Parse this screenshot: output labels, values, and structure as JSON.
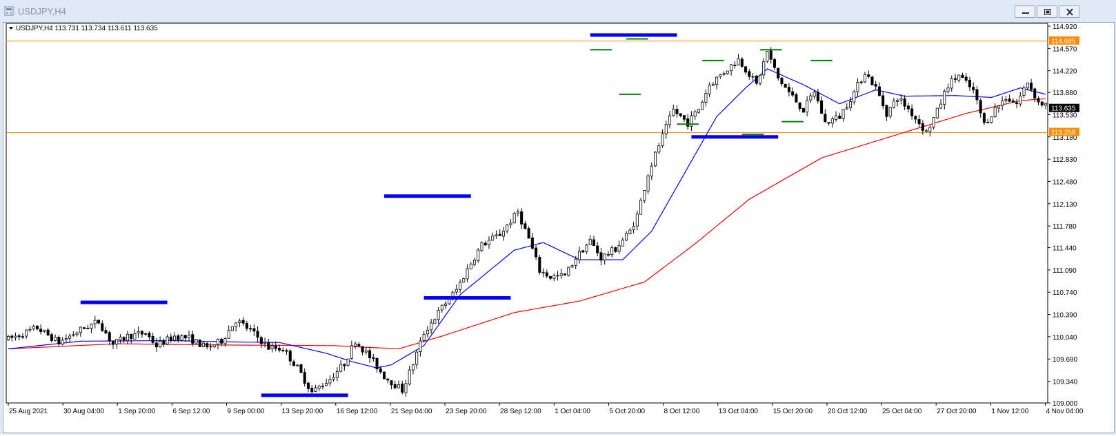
{
  "window": {
    "title": "USDJPY,H4",
    "buttons": [
      "minimize",
      "restore",
      "close"
    ]
  },
  "info": {
    "symbol": "USDJPY,H4",
    "ohlc": "113.731 113.734 113.611 113.635"
  },
  "colors": {
    "bull": "#ffffff",
    "bear": "#000000",
    "ma_fast": "#0000ff",
    "ma_slow": "#ff0000",
    "level": "#ff8c00",
    "zone": "#0000ff",
    "pivot": "#008000",
    "current_price_bg": "#000000"
  },
  "chart_data": {
    "type": "candlestick",
    "title": "USDJPY,H4",
    "ylim": [
      109.0,
      114.92
    ],
    "y_ticks": [
      "114.920",
      "114.570",
      "114.220",
      "113.880",
      "113.530",
      "113.180",
      "112.830",
      "112.480",
      "112.130",
      "111.780",
      "111.440",
      "111.090",
      "110.740",
      "110.390",
      "110.040",
      "109.690",
      "109.340",
      "109.000"
    ],
    "x_ticks": [
      "25 Aug 2021",
      "30 Aug 04:00",
      "1 Sep 20:00",
      "6 Sep 12:00",
      "9 Sep 00:00",
      "13 Sep 20:00",
      "16 Sep 12:00",
      "21 Sep 04:00",
      "23 Sep 20:00",
      "28 Sep 12:00",
      "1 Oct 04:00",
      "5 Oct 20:00",
      "8 Oct 12:00",
      "13 Oct 04:00",
      "15 Oct 20:00",
      "20 Oct 12:00",
      "25 Oct 04:00",
      "27 Oct 20:00",
      "1 Nov 12:00",
      "4 Nov 04:00"
    ],
    "horizontal_levels": [
      {
        "price": 114.695,
        "label": "114.695"
      },
      {
        "price": 113.258,
        "label": "113.258"
      }
    ],
    "current_price": {
      "price": 113.635,
      "label": "113.635"
    },
    "moving_averages": [
      "fast (blue)",
      "slow (red)"
    ],
    "price_path": [
      [
        0,
        110.0
      ],
      [
        8,
        110.18
      ],
      [
        14,
        109.95
      ],
      [
        20,
        110.15
      ],
      [
        25,
        110.28
      ],
      [
        29,
        109.92
      ],
      [
        33,
        110.05
      ],
      [
        38,
        110.1
      ],
      [
        41,
        109.9
      ],
      [
        46,
        110.05
      ],
      [
        50,
        110.02
      ],
      [
        55,
        109.86
      ],
      [
        59,
        109.98
      ],
      [
        63,
        110.3
      ],
      [
        67,
        110.14
      ],
      [
        72,
        109.87
      ],
      [
        76,
        109.85
      ],
      [
        80,
        109.55
      ],
      [
        84,
        109.17
      ],
      [
        89,
        109.38
      ],
      [
        93,
        109.62
      ],
      [
        96,
        109.98
      ],
      [
        100,
        109.72
      ],
      [
        104,
        109.42
      ],
      [
        109,
        109.2
      ],
      [
        112,
        109.62
      ],
      [
        115,
        110.1
      ],
      [
        120,
        110.5
      ],
      [
        124,
        110.78
      ],
      [
        128,
        111.2
      ],
      [
        131,
        111.48
      ],
      [
        136,
        111.65
      ],
      [
        141,
        112.0
      ],
      [
        144,
        111.58
      ],
      [
        147,
        111.08
      ],
      [
        150,
        110.98
      ],
      [
        154,
        111.0
      ],
      [
        157,
        111.28
      ],
      [
        161,
        111.55
      ],
      [
        164,
        111.28
      ],
      [
        168,
        111.42
      ],
      [
        172,
        111.7
      ],
      [
        174,
        111.95
      ],
      [
        177,
        112.6
      ],
      [
        180,
        113.05
      ],
      [
        184,
        113.6
      ],
      [
        188,
        113.4
      ],
      [
        191,
        113.62
      ],
      [
        194,
        114.0
      ],
      [
        198,
        114.2
      ],
      [
        202,
        114.4
      ],
      [
        204,
        114.25
      ],
      [
        207,
        114.0
      ],
      [
        210,
        114.52
      ],
      [
        213,
        114.1
      ],
      [
        216,
        113.88
      ],
      [
        220,
        113.6
      ],
      [
        223,
        113.9
      ],
      [
        226,
        113.4
      ],
      [
        230,
        113.5
      ],
      [
        234,
        113.88
      ],
      [
        237,
        114.2
      ],
      [
        240,
        113.95
      ],
      [
        243,
        113.55
      ],
      [
        246,
        113.8
      ],
      [
        249,
        113.62
      ],
      [
        252,
        113.4
      ],
      [
        254,
        113.25
      ],
      [
        257,
        113.58
      ],
      [
        260,
        114.0
      ],
      [
        263,
        114.15
      ],
      [
        267,
        113.9
      ],
      [
        270,
        113.38
      ],
      [
        273,
        113.62
      ],
      [
        276,
        113.8
      ],
      [
        279,
        113.7
      ],
      [
        282,
        114.05
      ],
      [
        285,
        113.72
      ],
      [
        287,
        113.68
      ]
    ],
    "ma_fast": [
      [
        0,
        109.85
      ],
      [
        20,
        109.97
      ],
      [
        45,
        109.98
      ],
      [
        60,
        109.96
      ],
      [
        75,
        109.95
      ],
      [
        88,
        109.78
      ],
      [
        95,
        109.65
      ],
      [
        102,
        109.55
      ],
      [
        106,
        109.6
      ],
      [
        115,
        109.9
      ],
      [
        125,
        110.7
      ],
      [
        140,
        111.4
      ],
      [
        148,
        111.52
      ],
      [
        158,
        111.25
      ],
      [
        170,
        111.25
      ],
      [
        178,
        111.7
      ],
      [
        184,
        112.3
      ],
      [
        190,
        112.9
      ],
      [
        196,
        113.5
      ],
      [
        204,
        113.95
      ],
      [
        210,
        114.25
      ],
      [
        220,
        114.0
      ],
      [
        230,
        113.7
      ],
      [
        240,
        113.92
      ],
      [
        248,
        113.82
      ],
      [
        262,
        113.83
      ],
      [
        272,
        113.8
      ],
      [
        280,
        113.95
      ],
      [
        287,
        113.85
      ]
    ],
    "ma_slow": [
      [
        0,
        109.85
      ],
      [
        30,
        109.93
      ],
      [
        60,
        109.91
      ],
      [
        90,
        109.9
      ],
      [
        108,
        109.85
      ],
      [
        120,
        110.05
      ],
      [
        140,
        110.42
      ],
      [
        158,
        110.6
      ],
      [
        176,
        110.9
      ],
      [
        190,
        111.5
      ],
      [
        205,
        112.2
      ],
      [
        225,
        112.85
      ],
      [
        245,
        113.2
      ],
      [
        265,
        113.55
      ],
      [
        280,
        113.75
      ],
      [
        287,
        113.78
      ]
    ],
    "annotations": [
      {
        "type": "resistance-zone",
        "price": 110.58,
        "from": 20,
        "to": 44
      },
      {
        "type": "support-zone",
        "price": 109.12,
        "from": 70,
        "to": 94
      },
      {
        "type": "resistance-zone",
        "price": 112.25,
        "from": 104,
        "to": 128
      },
      {
        "type": "support-zone",
        "price": 110.65,
        "from": 115,
        "to": 139
      },
      {
        "type": "resistance-zone",
        "price": 114.78,
        "from": 161,
        "to": 185
      },
      {
        "type": "support-zone",
        "price": 113.18,
        "from": 189,
        "to": 213
      },
      {
        "type": "swing-high",
        "price": 114.55,
        "from": 161,
        "to": 167
      },
      {
        "type": "swing-high",
        "price": 114.72,
        "from": 171,
        "to": 177
      },
      {
        "type": "swing-low",
        "price": 113.85,
        "from": 169,
        "to": 175
      },
      {
        "type": "swing-low",
        "price": 113.38,
        "from": 185,
        "to": 191
      },
      {
        "type": "swing-high",
        "price": 114.38,
        "from": 192,
        "to": 198
      },
      {
        "type": "swing-low",
        "price": 113.22,
        "from": 203,
        "to": 209
      },
      {
        "type": "swing-high",
        "price": 114.55,
        "from": 208,
        "to": 214
      },
      {
        "type": "swing-low",
        "price": 113.42,
        "from": 214,
        "to": 220
      },
      {
        "type": "swing-high",
        "price": 114.38,
        "from": 222,
        "to": 228
      }
    ],
    "grid": false,
    "bars": 288
  }
}
